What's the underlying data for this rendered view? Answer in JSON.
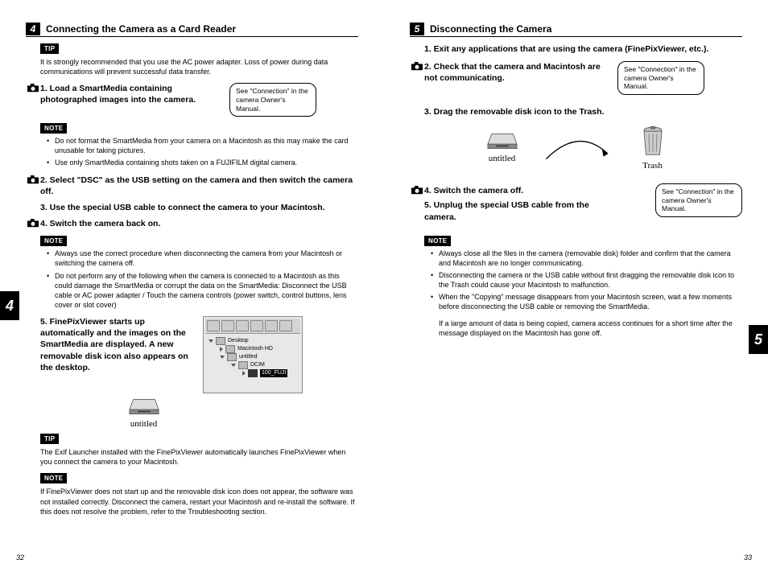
{
  "left": {
    "sectionNum": "4",
    "sectionTitle": "Connecting the Camera as a Card Reader",
    "tipLabel": "TIP",
    "tipText": "It is strongly recommended that you use the AC power adapter. Loss of power during data communications will prevent successful data transfer.",
    "step1": "1.  Load a SmartMedia containing photographed images into the camera.",
    "callout1": "See \"Connection\" in the camera Owner's Manual.",
    "noteLabel1": "NOTE",
    "note_b1": "Do not format the SmartMedia from your camera on a Macintosh as this may make the card unusable for taking pictures.",
    "note_b2": "Use only SmartMedia containing shots taken on a FUJIFILM digital camera.",
    "step2": "2.  Select \"DSC\" as the USB setting on the camera and then switch the camera off.",
    "step3": "3.  Use the special USB cable to connect the camera to your Macintosh.",
    "step4": "4.  Switch the camera back on.",
    "noteLabel2": "NOTE",
    "note2_b1": "Always use the correct procedure when disconnecting the camera from your Macintosh or switching the camera off.",
    "note2_b2": "Do not perform any of the following when the camera is connected to a Macintosh as this could damage the SmartMedia or corrupt the data on the SmartMedia: Disconnect the USB cable or AC power adapter / Touch the camera controls (power switch, control buttons, lens cover or slot cover)",
    "step5": "5.  FinePixViewer starts up automatically and the images on the SmartMedia are displayed. A new removable disk icon also appears on the desktop.",
    "untitled": "untitled",
    "ss": {
      "desktop": "Desktop",
      "hd": "Macintosh HD",
      "unt": "untitled",
      "dcim": "DCIM",
      "folder": "100_FUJI"
    },
    "tipLabel2": "TIP",
    "tip2": "The Exif Launcher installed with the FinePixViewer automatically launches FinePixViewer when you connect the camera to your Macintosh.",
    "noteLabel3": "NOTE",
    "note3": "If FinePixViewer does not start up and the removable disk icon does not appear, the software was not installed correctly. Disconnect the camera, restart your Macintosh and re-install the software. If this does not resolve the problem, refer to the Troubleshooting section.",
    "tab": "4",
    "pageNum": "32"
  },
  "right": {
    "sectionNum": "5",
    "sectionTitle": "Disconnecting the Camera",
    "step1": "1.  Exit any applications that are using the camera (FinePixViewer, etc.).",
    "step2": "2.  Check that the camera and Macintosh are not communicating.",
    "callout1": "See \"Connection\" in the camera Owner's Manual.",
    "step3": "3.  Drag the removable disk icon to the Trash.",
    "untitled": "untitled",
    "trash": "Trash",
    "step4": "4.  Switch the camera off.",
    "step5": "5.  Unplug the special USB cable from the camera.",
    "callout2": "See \"Connection\" in the camera Owner's Manual.",
    "noteLabel": "NOTE",
    "nb1": "Always close all the files in the camera (removable disk) folder and confirm that the camera and Macintosh are no longer communicating.",
    "nb2": "Disconnecting the camera or the USB cable without first dragging the removable disk icon to the Trash could cause your Macintosh to malfunction.",
    "nb3": "When the \"Copying\" message disappears from your Macintosh screen, wait a few moments before disconnecting the USB cable or removing the SmartMedia.",
    "nb3_sub": "If a large amount of data is being copied, camera access continues for a short time after the message displayed on the Macintosh has gone off.",
    "tab": "5",
    "pageNum": "33"
  }
}
